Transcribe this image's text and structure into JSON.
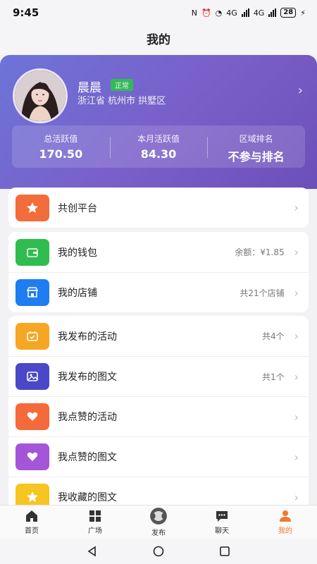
{
  "status_bar": {
    "time": "9:45",
    "network": "4G",
    "network2": "4G",
    "battery": "28"
  },
  "page_title": "我的",
  "profile": {
    "name": "晨晨",
    "badge": "正常",
    "location": "浙江省 杭州市 拱墅区",
    "stats": [
      {
        "label": "总活跃值",
        "value": "170.50"
      },
      {
        "label": "本月活跃值",
        "value": "84.30"
      },
      {
        "label": "区域排名",
        "value": "不参与排名"
      }
    ]
  },
  "menu_groups": [
    [
      {
        "label": "共创平台",
        "value": "",
        "icon": "star-icon",
        "color": "#f26c3c"
      }
    ],
    [
      {
        "label": "我的钱包",
        "value": "余额：¥1.85",
        "icon": "wallet-icon",
        "color": "#2fbd4f"
      },
      {
        "label": "我的店铺",
        "value": "共21个店铺",
        "icon": "store-icon",
        "color": "#1e7df0"
      }
    ],
    [
      {
        "label": "我发布的活动",
        "value": "共4个",
        "icon": "calendar-icon",
        "color": "#f5a623"
      },
      {
        "label": "我发布的图文",
        "value": "共1个",
        "icon": "image-icon",
        "color": "#4a47c8"
      },
      {
        "label": "我点赞的活动",
        "value": "",
        "icon": "heart-icon",
        "color": "#f46a3a"
      },
      {
        "label": "我点赞的图文",
        "value": "",
        "icon": "heart-icon",
        "color": "#a455d8"
      },
      {
        "label": "我收藏的图文",
        "value": "",
        "icon": "star-icon",
        "color": "#f7c520"
      }
    ]
  ],
  "tabs": [
    {
      "label": "首页",
      "icon": "home-icon"
    },
    {
      "label": "广场",
      "icon": "grid-icon"
    },
    {
      "label": "发布",
      "icon": "publish-icon"
    },
    {
      "label": "聊天",
      "icon": "chat-icon"
    },
    {
      "label": "我的",
      "icon": "person-icon",
      "active": true
    }
  ],
  "colors": {
    "accent": "#f07830",
    "header_gradient_start": "#6d74d8",
    "header_gradient_end": "#6c4fb8"
  }
}
